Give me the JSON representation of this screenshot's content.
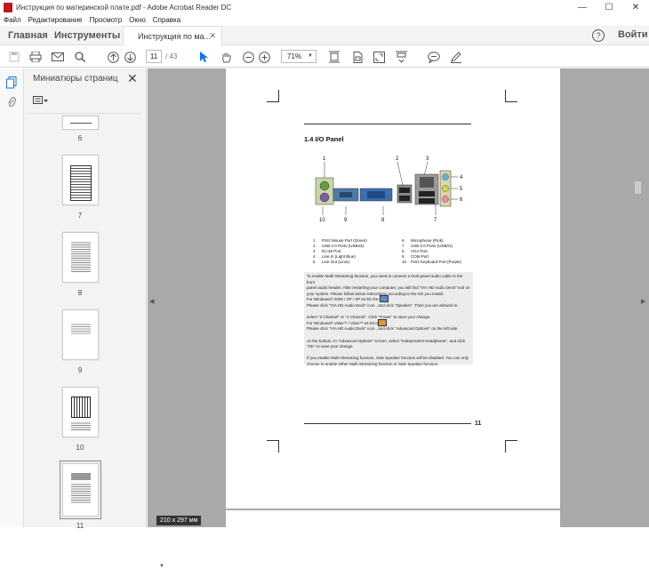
{
  "window": {
    "title": "Инструкция по материнской плате.pdf - Adobe Acrobat Reader DC",
    "controls": {
      "minimize": "—",
      "maximize": "☐",
      "close": "✕"
    }
  },
  "menu": [
    "Файл",
    "Редактирование",
    "Просмотр",
    "Окно",
    "Справка"
  ],
  "tabs": {
    "home": "Главная",
    "tools": "Инструменты",
    "document": "Инструкция по ма...",
    "sign_in": "Войти"
  },
  "toolbar": {
    "page_current": "11",
    "page_separator": "/",
    "page_total": "43",
    "zoom": "71%"
  },
  "thumbnails_panel": {
    "title": "Миниатюры страниц",
    "pages": [
      "6",
      "7",
      "8",
      "9",
      "10",
      "11"
    ],
    "selected_page": "11"
  },
  "document": {
    "section_title": "1.4 I/O Panel",
    "page_number": "11",
    "diagram_numbers_top": [
      "1",
      "2",
      "3",
      "4",
      "5",
      "6"
    ],
    "diagram_numbers_bottom": [
      "10",
      "9",
      "8",
      "7"
    ],
    "legend": [
      [
        "1",
        "PS/2 Mouse Port (Green)",
        "6",
        "Microphone (Pink)"
      ],
      [
        "2",
        "USB 2.0 Ports (USB23)",
        "7",
        "USB 2.0 Ports (USB01)"
      ],
      [
        "3",
        "RJ-45 Port",
        "8",
        "VGA Port"
      ],
      [
        "4",
        "Line In (Light Blue)",
        "9",
        "COM Port"
      ],
      [
        "5",
        "Line Out (Lime)",
        "10",
        "PS/2 Keyboard Port (Purple)"
      ]
    ],
    "body_text": "To enable Multi-Streaming function, you need to connect a front panel audio cable to the front\npanel audio header. After restarting your computer, you will find \"VIA HD Audio Deck\" tool on\nyour system. Please follow below instructions according to the OS you install.\nFor Windows® 2000 / XP / XP 64-bit OS:\nPlease click \"VIA HD Audio Deck\" icon        , and click \"Speaker\". Then you are allowed to\n\nselect \"2 Channel\" or \"4 Channel\". Click \"Power\" to save your change.\nFor Windows® Vista™ / Vista™ 64-bit OS:\nPlease click \"VIA HD Audio Deck\" icon        , and click \"Advanced Options\" on the left side\n\non the bottom. In \"Advanced Options\" screen, select \"Independent Headphone\", and click\n\"OK\" to save your change.\n\nIf you enable Multi-Streaming function, Side Speaker function will be disabled. You can only\nchoose to enable either Multi-Streaming function or Side Speaker function.",
    "page_size": "210 x 297 мм"
  },
  "colors": {
    "viewer_bg": "#a9a9a9",
    "accent_select": "#1473e6",
    "app_icon": "#c4161c"
  }
}
